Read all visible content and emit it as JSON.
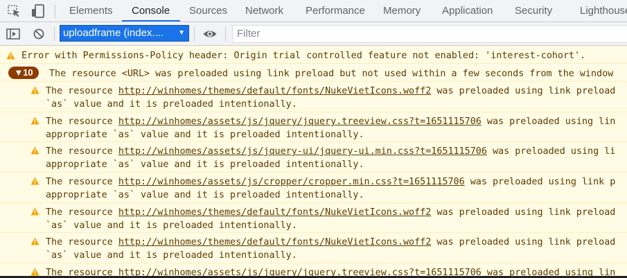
{
  "tabs": [
    {
      "label": "Elements"
    },
    {
      "label": "Console"
    },
    {
      "label": "Sources"
    },
    {
      "label": "Network"
    },
    {
      "label": "Performance"
    },
    {
      "label": "Memory"
    },
    {
      "label": "Application"
    },
    {
      "label": "Security"
    },
    {
      "label": "Lighthouse"
    }
  ],
  "active_tab": "Console",
  "toolbar": {
    "context": "uploadframe (index....",
    "filter_placeholder": "Filter"
  },
  "icons": {
    "inspect": "inspect-element-icon",
    "device": "device-toolbar-icon",
    "sidebar": "console-sidebar-icon",
    "clear": "clear-console-icon",
    "eye": "live-expression-eye-icon",
    "warning": "warning-icon"
  },
  "colors": {
    "accent": "#1a73e8",
    "warning_bg": "#fffbe5",
    "warning_text": "#5c3c00",
    "warning_icon": "#f2a600",
    "badge_bg": "#8e3c00"
  },
  "console": {
    "permissions_error": "Error with Permissions-Policy header: Origin trial controlled feature not enabled: 'interest-cohort'.",
    "group": {
      "count": "▼10",
      "text": "The resource <URL> was preloaded using link preload but not used within a few seconds from the window"
    },
    "messages": [
      {
        "pre": "The resource ",
        "url": "http://winhomes/themes/default/fonts/NukeVietIcons.woff2",
        "post": " was preloaded using link preload",
        "line2": "`as` value and it is preloaded intentionally."
      },
      {
        "pre": "The resource ",
        "url": "http://winhomes/assets/js/jquery/jquery.treeview.css?t=1651115706",
        "post": " was preloaded using lin",
        "line2": "appropriate `as` value and it is preloaded intentionally."
      },
      {
        "pre": "The resource ",
        "url": "http://winhomes/assets/js/jquery-ui/jquery-ui.min.css?t=1651115706",
        "post": " was preloaded using li",
        "line2": "appropriate `as` value and it is preloaded intentionally."
      },
      {
        "pre": "The resource ",
        "url": "http://winhomes/assets/js/cropper/cropper.min.css?t=1651115706",
        "post": " was preloaded using link p",
        "line2": "appropriate `as` value and it is preloaded intentionally."
      },
      {
        "pre": "The resource ",
        "url": "http://winhomes/themes/default/fonts/NukeVietIcons.woff2",
        "post": " was preloaded using link preload",
        "line2": "`as` value and it is preloaded intentionally."
      },
      {
        "pre": "The resource ",
        "url": "http://winhomes/themes/default/fonts/NukeVietIcons.woff2",
        "post": " was preloaded using link preload",
        "line2": "`as` value and it is preloaded intentionally."
      },
      {
        "pre": "The resource ",
        "url": "http://winhomes/assets/js/jquery/jquery.treeview.css?t=1651115706",
        "post": " was preloaded using lin",
        "line2": ""
      }
    ]
  }
}
